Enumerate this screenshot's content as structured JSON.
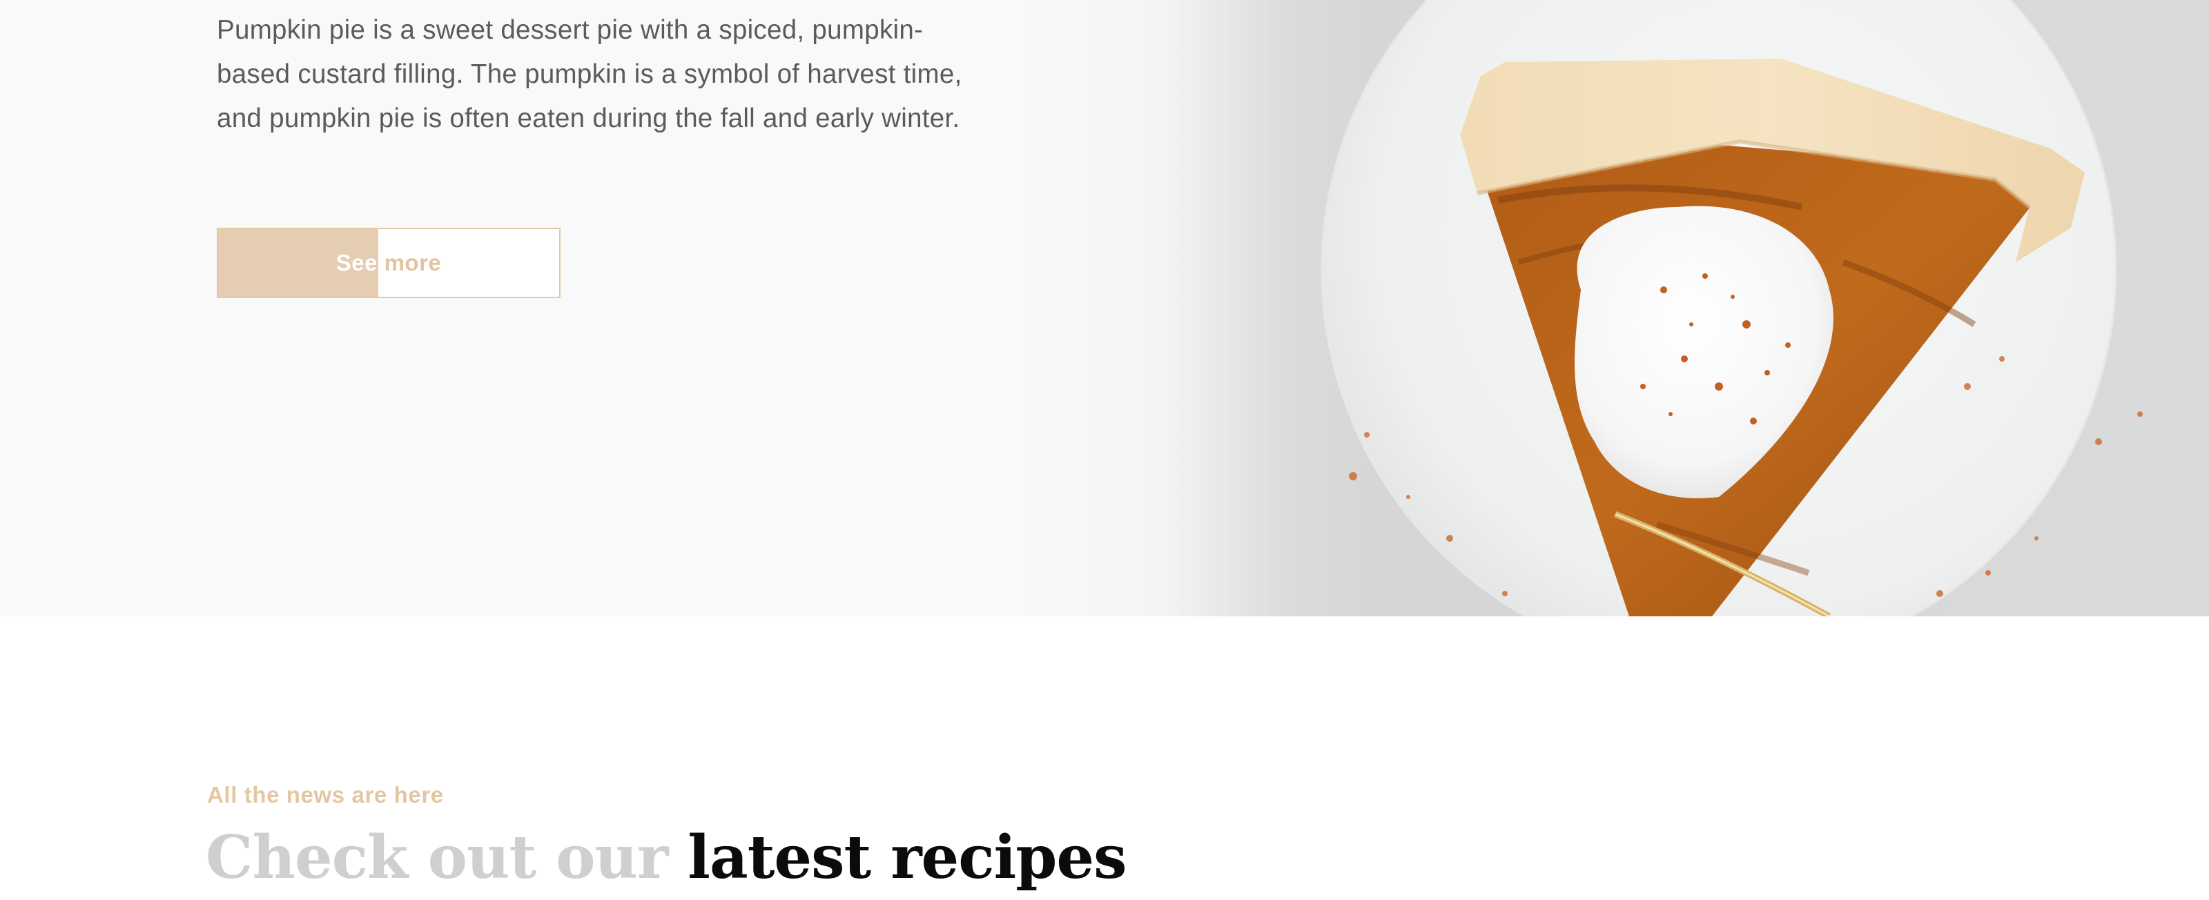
{
  "hero": {
    "description": "Pumpkin pie is a sweet dessert pie with a spiced, pumpkin-based custard filling. The pumpkin is a symbol of harvest time, and pumpkin pie is often eaten during the fall and early winter.",
    "button_label": "See more",
    "image_subject": "pumpkin-pie-slice-with-whipped-cream"
  },
  "latest": {
    "eyebrow": "All the news are here",
    "heading_muted": "Check out our",
    "heading_strong": "latest recipes"
  },
  "colors": {
    "accent": "#e4cdb0",
    "hero_background": "#f9f9f9",
    "body_text": "#5b5b5b",
    "heading_muted": "#cfcfcf",
    "heading_strong": "#0b0b0b"
  }
}
